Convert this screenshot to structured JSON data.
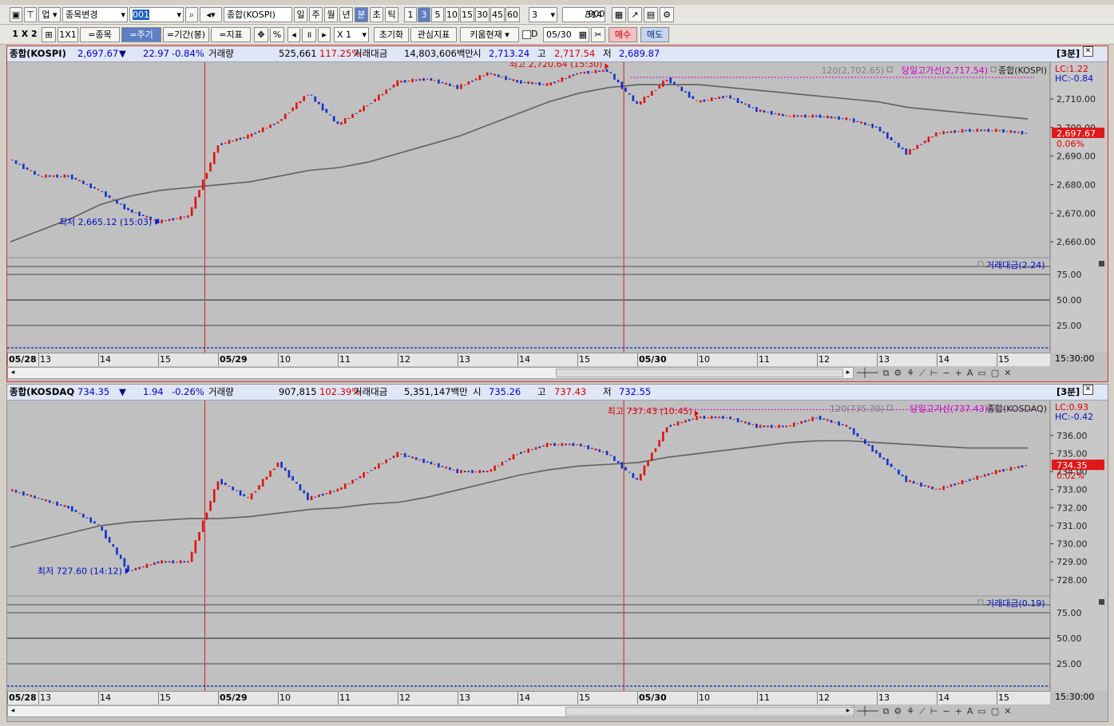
{
  "toolbar1": {
    "market": "업",
    "stock_change": "종목변경",
    "code_value": "001",
    "index_name": "종합(KOSPI)",
    "period_tabs": [
      "일",
      "주",
      "월",
      "년",
      "분",
      "초",
      "틱"
    ],
    "minute_tabs": [
      "1",
      "3",
      "5",
      "10",
      "15",
      "30",
      "45",
      "60"
    ],
    "active_period": "분",
    "active_minute": "3",
    "interval_value": "3",
    "count_value": "314",
    "count_total": "/900"
  },
  "toolbar2": {
    "layout_1x2": "1 X 2",
    "layout_1x1": "1X1",
    "btn_stock": "=종목",
    "btn_cycle": "=주기",
    "btn_period": "=기간(봉)",
    "btn_indicator": "=지표",
    "percent": "%",
    "zoom": "X 1",
    "btn_reset": "초기화",
    "btn_watch": "관심지표",
    "btn_kiwoom": "키움현재",
    "date_prefix": "D",
    "date_value": "05/30",
    "btn_buy": "매수",
    "btn_sell": "매도"
  },
  "panels": [
    {
      "name": "종합(KOSPI)",
      "price": "2,697.67",
      "arrow": "▼",
      "change": "22.97",
      "change_pct": "-0.84%",
      "vol_label": "거래량",
      "volume": "525,661",
      "volume_pct": "117.25%",
      "amt_label": "거래대금",
      "amount": "14,803,606백만",
      "open_label": "시",
      "open": "2,713.24",
      "high_label": "고",
      "high": "2,717.54",
      "low_label": "저",
      "low": "2,689.87",
      "timeframe": "[3분]",
      "ma_label": "120(2,702.65)",
      "day_high_line": "당일고가선(2,717.54)",
      "series_label": "종합(KOSPI)",
      "lc": "LC:1.22",
      "hc": "HC:-0.84",
      "current_tag": "2,697.67",
      "current_pct": "0.06%",
      "high_annot": "최고 2,720.64 (15:30)",
      "low_annot": "최저 2,665.12 (15:03)",
      "y_ticks": [
        "2,710.00",
        "2,700.00",
        "2,690.00",
        "2,680.00",
        "2,670.00",
        "2,660.00"
      ],
      "ylim": [
        2655,
        2722
      ],
      "sub_label": "거래대금(2.24)",
      "sub_ticks": [
        "75.00",
        "50.00",
        "25.00"
      ],
      "date_labels": [
        "05/28",
        "13",
        "14",
        "15",
        "05/29",
        "10",
        "11",
        "12",
        "13",
        "14",
        "15",
        "05/30",
        "10",
        "11",
        "12",
        "13",
        "14",
        "15"
      ],
      "time_label": "15:30:00"
    },
    {
      "name": "종합(KOSDAQ",
      "price": "734.35",
      "arrow": "▼",
      "change": "1.94",
      "change_pct": "-0.26%",
      "vol_label": "거래량",
      "volume": "907,815",
      "volume_pct": "102.39%",
      "amt_label": "거래대금",
      "amount": "5,351,147백만",
      "open_label": "시",
      "open": "735.26",
      "high_label": "고",
      "high": "737.43",
      "low_label": "저",
      "low": "732.55",
      "timeframe": "[3분]",
      "ma_label": "120(735.30)",
      "day_high_line": "당일고가선(737.43)",
      "series_label": "종합(KOSDAQ)",
      "lc": "LC:0.93",
      "hc": "HC:-0.42",
      "current_tag": "734.35",
      "current_pct": "0.02%",
      "high_annot": "최고 737.43 (10:45)",
      "low_annot": "최저 727.60 (14:12)",
      "y_ticks": [
        "736.00",
        "735.00",
        "734.00",
        "733.00",
        "732.00",
        "731.00",
        "730.00",
        "729.00",
        "728.00"
      ],
      "ylim": [
        727.2,
        737.8
      ],
      "sub_label": "거래대금(0.19)",
      "sub_ticks": [
        "75.00",
        "50.00",
        "25.00"
      ],
      "date_labels": [
        "05/28",
        "13",
        "14",
        "15",
        "05/29",
        "10",
        "11",
        "12",
        "13",
        "14",
        "15",
        "05/30",
        "10",
        "11",
        "12",
        "13",
        "14",
        "15"
      ],
      "time_label": "15:30:00"
    }
  ],
  "chart_data": [
    {
      "type": "line",
      "title": "종합(KOSPI)",
      "x": [
        "05/28 12:40",
        "05/28 13:00",
        "05/28 13:30",
        "05/28 14:00",
        "05/28 14:30",
        "05/28 15:00",
        "05/28 15:30",
        "05/29 09:00",
        "05/29 09:30",
        "05/29 10:00",
        "05/29 10:30",
        "05/29 11:00",
        "05/29 11:30",
        "05/29 12:00",
        "05/29 12:30",
        "05/29 13:00",
        "05/29 13:30",
        "05/29 14:00",
        "05/29 14:30",
        "05/29 15:00",
        "05/29 15:30",
        "05/30 09:00",
        "05/30 09:30",
        "05/30 10:00",
        "05/30 10:30",
        "05/30 11:00",
        "05/30 11:30",
        "05/30 12:00",
        "05/30 12:30",
        "05/30 13:00",
        "05/30 13:30",
        "05/30 14:00",
        "05/30 14:30",
        "05/30 15:00",
        "05/30 15:30"
      ],
      "series": [
        {
          "name": "종합(KOSPI)",
          "values": [
            2689,
            2683,
            2683,
            2678,
            2671,
            2667,
            2669,
            2694,
            2697,
            2702,
            2712,
            2701,
            2708,
            2716,
            2717,
            2714,
            2719,
            2716,
            2715,
            2719,
            2720,
            2708,
            2717,
            2709,
            2711,
            2706,
            2704,
            2704,
            2703,
            2700,
            2691,
            2698,
            2699,
            2699,
            2698
          ]
        },
        {
          "name": "120",
          "values": [
            2660,
            2664,
            2668,
            2673,
            2676,
            2678,
            2679,
            2680,
            2681,
            2683,
            2685,
            2686,
            2688,
            2691,
            2694,
            2697,
            2701,
            2705,
            2709,
            2712,
            2714,
            2715,
            2715,
            2715,
            2714,
            2713,
            2712,
            2711,
            2710,
            2709,
            2707,
            2706,
            2705,
            2704,
            2703
          ]
        }
      ],
      "reference_lines": {
        "day_high": 2717.54
      },
      "ylim": [
        2655,
        2722
      ]
    },
    {
      "type": "line",
      "title": "종합(KOSDAQ)",
      "x": [
        "05/28 12:40",
        "05/28 13:00",
        "05/28 13:30",
        "05/28 14:00",
        "05/28 14:30",
        "05/28 15:00",
        "05/28 15:30",
        "05/29 09:00",
        "05/29 09:30",
        "05/29 10:00",
        "05/29 10:30",
        "05/29 11:00",
        "05/29 11:30",
        "05/29 12:00",
        "05/29 12:30",
        "05/29 13:00",
        "05/29 13:30",
        "05/29 14:00",
        "05/29 14:30",
        "05/29 15:00",
        "05/29 15:30",
        "05/30 09:00",
        "05/30 09:30",
        "05/30 10:00",
        "05/30 10:30",
        "05/30 11:00",
        "05/30 11:30",
        "05/30 12:00",
        "05/30 12:30",
        "05/30 13:00",
        "05/30 13:30",
        "05/30 14:00",
        "05/30 14:30",
        "05/30 15:00",
        "05/30 15:30"
      ],
      "series": [
        {
          "name": "종합(KOSDAQ)",
          "values": [
            733.0,
            732.5,
            732.0,
            731.0,
            728.5,
            729.0,
            729.0,
            733.5,
            732.5,
            734.5,
            732.5,
            733.0,
            734.0,
            735.0,
            734.5,
            734.0,
            734.0,
            735.0,
            735.5,
            735.5,
            735.0,
            733.5,
            736.5,
            737.0,
            737.0,
            736.5,
            736.5,
            737.0,
            736.5,
            735.0,
            733.5,
            733.0,
            733.5,
            734.0,
            734.35
          ]
        },
        {
          "name": "120",
          "values": [
            729.8,
            730.2,
            730.6,
            731.0,
            731.2,
            731.3,
            731.4,
            731.4,
            731.5,
            731.7,
            731.9,
            732.0,
            732.2,
            732.3,
            732.6,
            733.0,
            733.4,
            733.8,
            734.1,
            734.3,
            734.4,
            734.5,
            734.8,
            735.0,
            735.2,
            735.4,
            735.6,
            735.7,
            735.7,
            735.6,
            735.5,
            735.4,
            735.3,
            735.3,
            735.3
          ]
        }
      ],
      "reference_lines": {
        "day_high": 737.43
      },
      "ylim": [
        727.2,
        737.8
      ]
    }
  ]
}
